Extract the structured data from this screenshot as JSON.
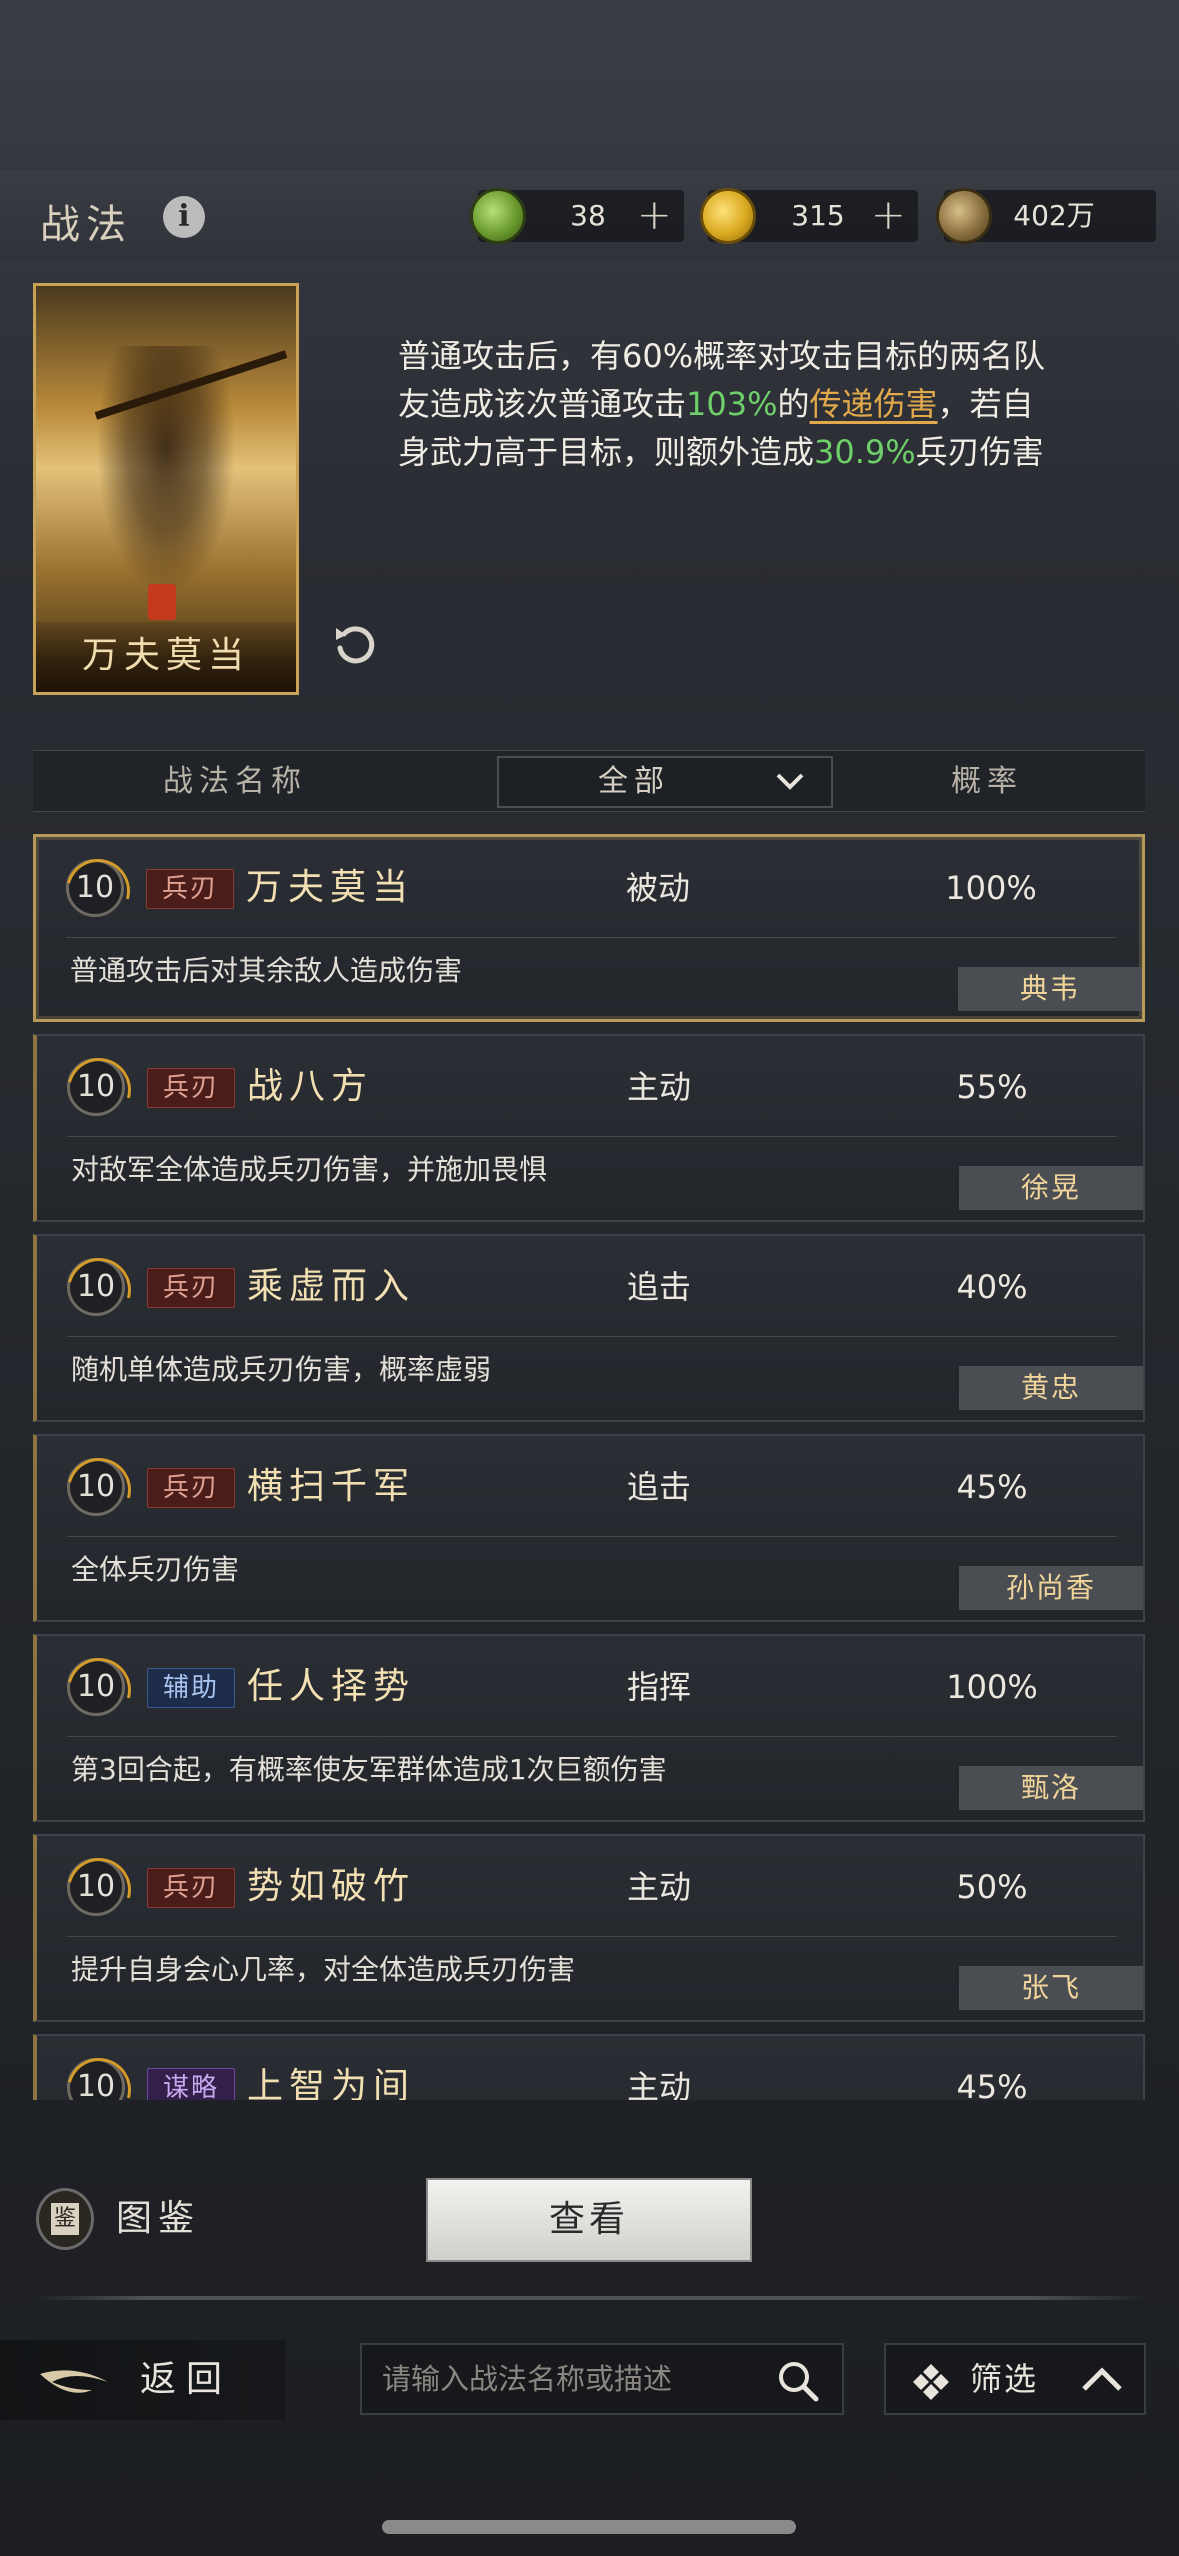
{
  "header": {
    "title": "战法",
    "info_icon": "info-icon",
    "resources": [
      {
        "icon": "jade-icon",
        "value": "38",
        "plus": "+"
      },
      {
        "icon": "gold-coin-icon",
        "value": "315",
        "plus": "+"
      },
      {
        "icon": "copper-coin-icon",
        "value": "402万"
      }
    ]
  },
  "selected_skill": {
    "card_name": "万夫莫当",
    "desc_parts": [
      {
        "text": "普通攻击后，有60%概率对攻击目标的两名队友造成该次普通攻击",
        "style": "normal"
      },
      {
        "text": "103%",
        "style": "green"
      },
      {
        "text": "的",
        "style": "normal"
      },
      {
        "text": "传递伤害",
        "style": "orange"
      },
      {
        "text": "，若自身武力高于目标，则额外造成",
        "style": "normal"
      },
      {
        "text": "30.9%",
        "style": "green"
      },
      {
        "text": "兵刃伤害",
        "style": "normal"
      }
    ]
  },
  "columns": {
    "name": "战法名称",
    "filter": "全部",
    "rate": "概率"
  },
  "skills": [
    {
      "level": "10",
      "type": "兵刃",
      "type_class": "blade",
      "name": "万夫莫当",
      "mode": "被动",
      "rate": "100%",
      "desc": "普通攻击后对其余敌人造成伤害",
      "hero": "典韦",
      "selected": true
    },
    {
      "level": "10",
      "type": "兵刃",
      "type_class": "blade",
      "name": "战八方",
      "mode": "主动",
      "rate": "55%",
      "desc": "对敌军全体造成兵刃伤害，并施加畏惧",
      "hero": "徐晃"
    },
    {
      "level": "10",
      "type": "兵刃",
      "type_class": "blade",
      "name": "乘虚而入",
      "mode": "追击",
      "rate": "40%",
      "desc": "随机单体造成兵刃伤害，概率虚弱",
      "hero": "黄忠"
    },
    {
      "level": "10",
      "type": "兵刃",
      "type_class": "blade",
      "name": "横扫千军",
      "mode": "追击",
      "rate": "45%",
      "desc": "全体兵刃伤害",
      "hero": "孙尚香"
    },
    {
      "level": "10",
      "type": "辅助",
      "type_class": "assist",
      "name": "任人择势",
      "mode": "指挥",
      "rate": "100%",
      "desc": "第3回合起，有概率使友军群体造成1次巨额伤害",
      "hero": "甄洛"
    },
    {
      "level": "10",
      "type": "兵刃",
      "type_class": "blade",
      "name": "势如破竹",
      "mode": "主动",
      "rate": "50%",
      "desc": "提升自身会心几率，对全体造成兵刃伤害",
      "hero": "张飞"
    },
    {
      "level": "10",
      "type": "谋略",
      "type_class": "strat",
      "name": "上智为间",
      "mode": "主动",
      "rate": "45%",
      "desc": "",
      "hero": ""
    }
  ],
  "bottom": {
    "atlas_label": "图鉴",
    "atlas_icon_char": "鉴",
    "view_button": "查看",
    "back_label": "返回",
    "search_placeholder": "请输入战法名称或描述",
    "screen_label": "筛选"
  }
}
